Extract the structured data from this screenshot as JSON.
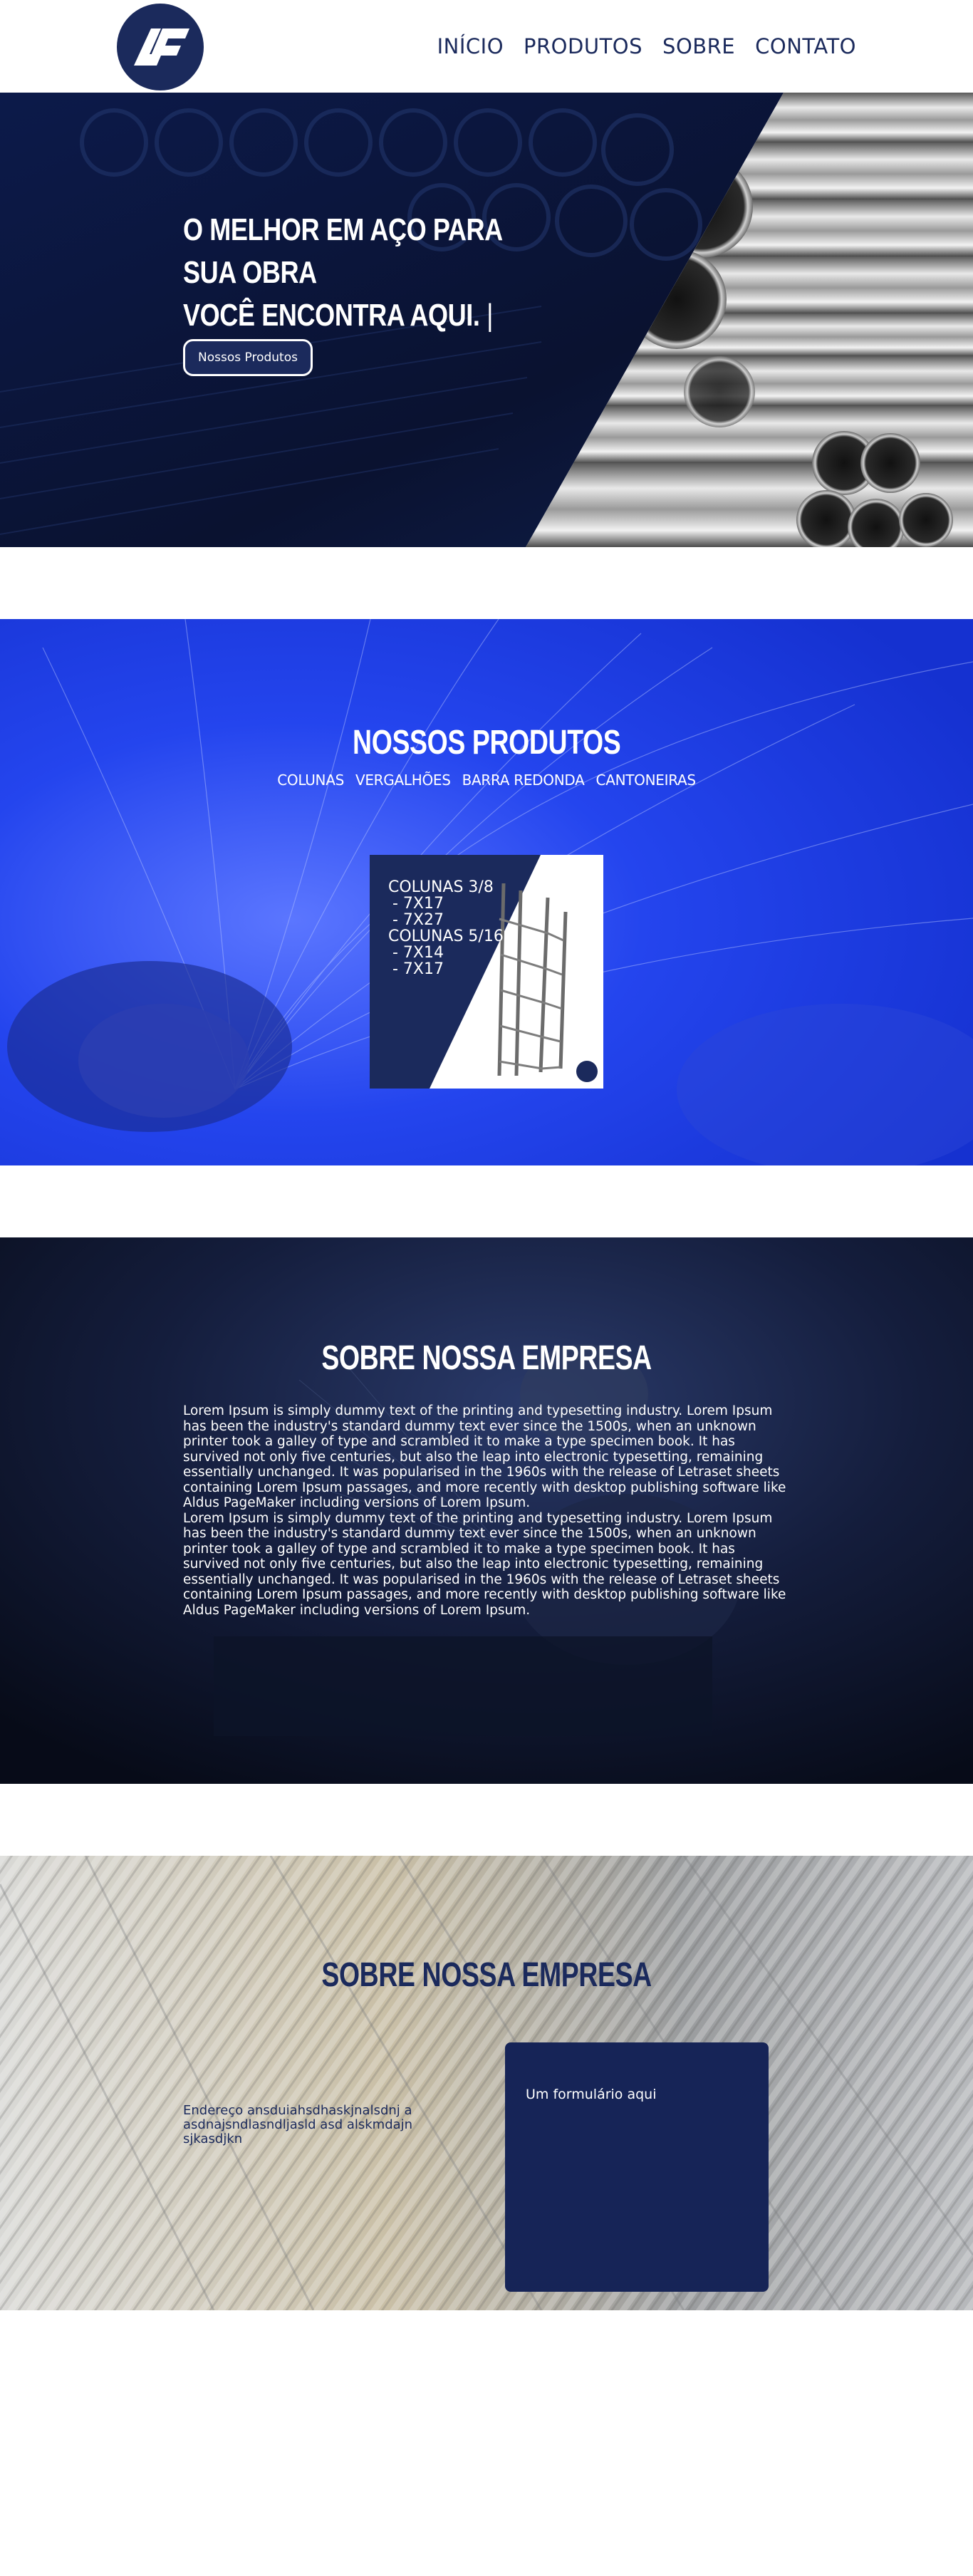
{
  "brand": {
    "logo_text": "AF",
    "color": "#1b2a5c"
  },
  "nav": {
    "items": [
      "INÍCIO",
      "PRODUTOS",
      "SOBRE",
      "CONTATO"
    ]
  },
  "hero": {
    "title_line1": "O MELHOR EM AÇO PARA SUA OBRA",
    "title_line2": "VOCÊ ENCONTRA AQUI.",
    "caret": "|",
    "button_label": "Nossos Produtos"
  },
  "products": {
    "title": "NOSSOS PRODUTOS",
    "categories": [
      "COLUNAS",
      "VERGALHÕES",
      "BARRA REDONDA",
      "CANTONEIRAS"
    ],
    "card": {
      "lines": [
        "COLUNAS 3/8",
        " - 7X17",
        " - 7X27",
        "COLUNAS 5/16",
        " - 7X14",
        " - 7X17"
      ]
    }
  },
  "about": {
    "title": "SOBRE NOSSA EMPRESA",
    "paragraphs": [
      "Lorem Ipsum is simply dummy text of the printing and typesetting industry. Lorem Ipsum has been the industry's standard dummy text ever since the 1500s, when an unknown printer took a galley of type and scrambled it to make a type specimen book. It has survived not only five centuries, but also the leap into electronic typesetting, remaining essentially unchanged. It was popularised in the 1960s with the release of Letraset sheets containing Lorem Ipsum passages, and more recently with desktop publishing software like Aldus PageMaker including versions of Lorem Ipsum.",
      "Lorem Ipsum is simply dummy text of the printing and typesetting industry. Lorem Ipsum has been the industry's standard dummy text ever since the 1500s, when an unknown printer took a galley of type and scrambled it to make a type specimen book. It has survived not only five centuries, but also the leap into electronic typesetting, remaining essentially unchanged. It was popularised in the 1960s with the release of Letraset sheets containing Lorem Ipsum passages, and more recently with desktop publishing software like Aldus PageMaker including versions of Lorem Ipsum."
    ]
  },
  "contact": {
    "title": "SOBRE NOSSA EMPRESA",
    "address": "Endereço ansduiahsdhaskjnalsdnj aasdnajsndlasndljasld asd alskmdajnsjkasdjkn",
    "form_placeholder": "Um formulário aqui"
  },
  "colors": {
    "navy": "#1b2a5c",
    "blue": "#1a3ae0",
    "form": "#162457"
  }
}
